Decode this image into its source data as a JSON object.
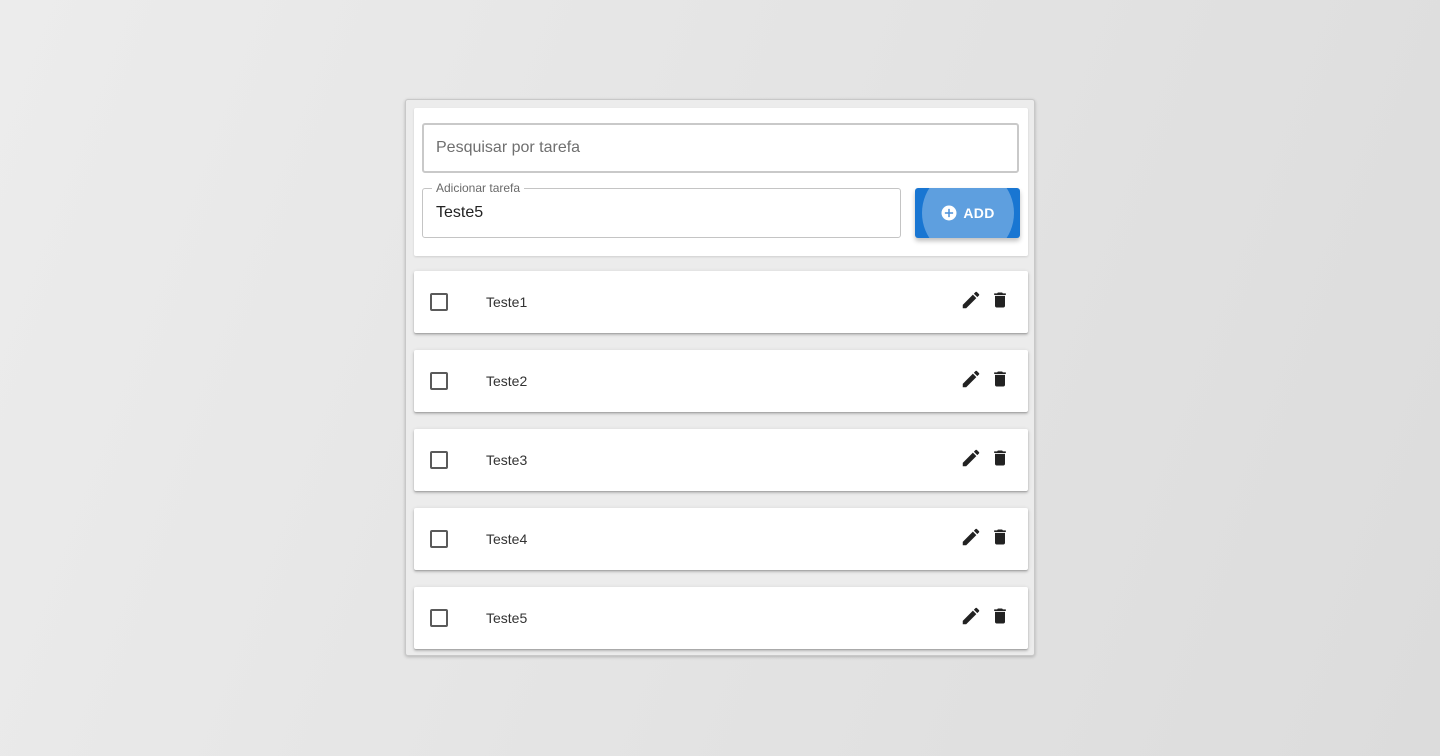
{
  "search": {
    "placeholder": "Pesquisar por tarefa",
    "value": ""
  },
  "add_task": {
    "label": "Adicionar tarefa",
    "value": "Teste5",
    "button_label": "ADD",
    "button_icon": "add-circle-icon",
    "button_color": "#1976d2"
  },
  "tasks": [
    {
      "label": "Teste1",
      "checked": false
    },
    {
      "label": "Teste2",
      "checked": false
    },
    {
      "label": "Teste3",
      "checked": false
    },
    {
      "label": "Teste4",
      "checked": false
    },
    {
      "label": "Teste5",
      "checked": false
    }
  ],
  "task_actions": {
    "edit_icon": "pencil-icon",
    "delete_icon": "trash-icon"
  }
}
